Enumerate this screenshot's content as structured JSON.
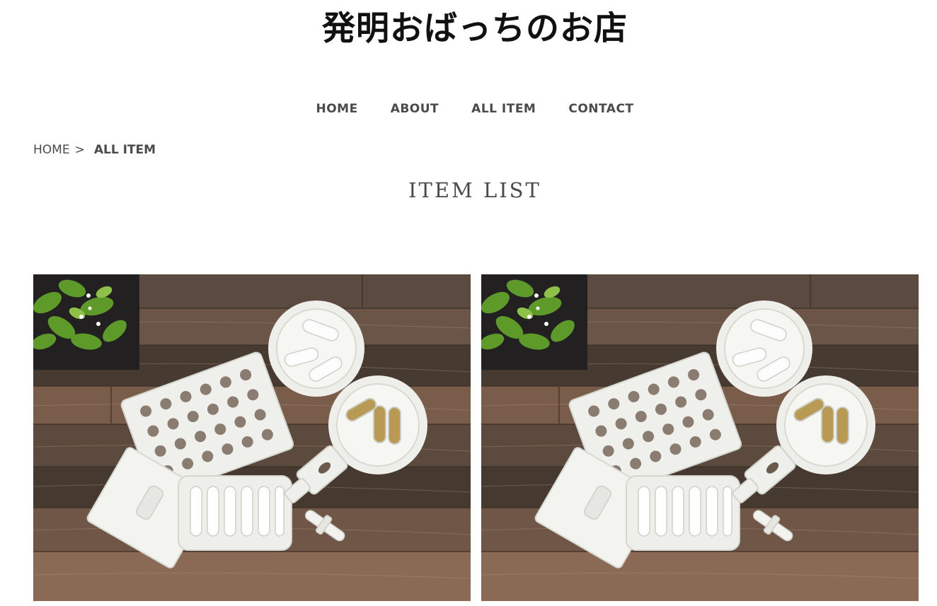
{
  "header": {
    "shop_title": "発明おばっちのお店"
  },
  "nav": {
    "items": [
      {
        "label": "HOME"
      },
      {
        "label": "ABOUT"
      },
      {
        "label": "ALL ITEM"
      },
      {
        "label": "CONTACT"
      }
    ]
  },
  "breadcrumb": {
    "home": "HOME",
    "separator": ">",
    "current": "ALL ITEM"
  },
  "main": {
    "section_title": "ITEM LIST"
  },
  "colors": {
    "text": "#4a4a4a",
    "title": "#111111",
    "wood_dark": "#4e4238",
    "wood_light": "#8a6a55",
    "product_white": "#f2f2ef"
  }
}
